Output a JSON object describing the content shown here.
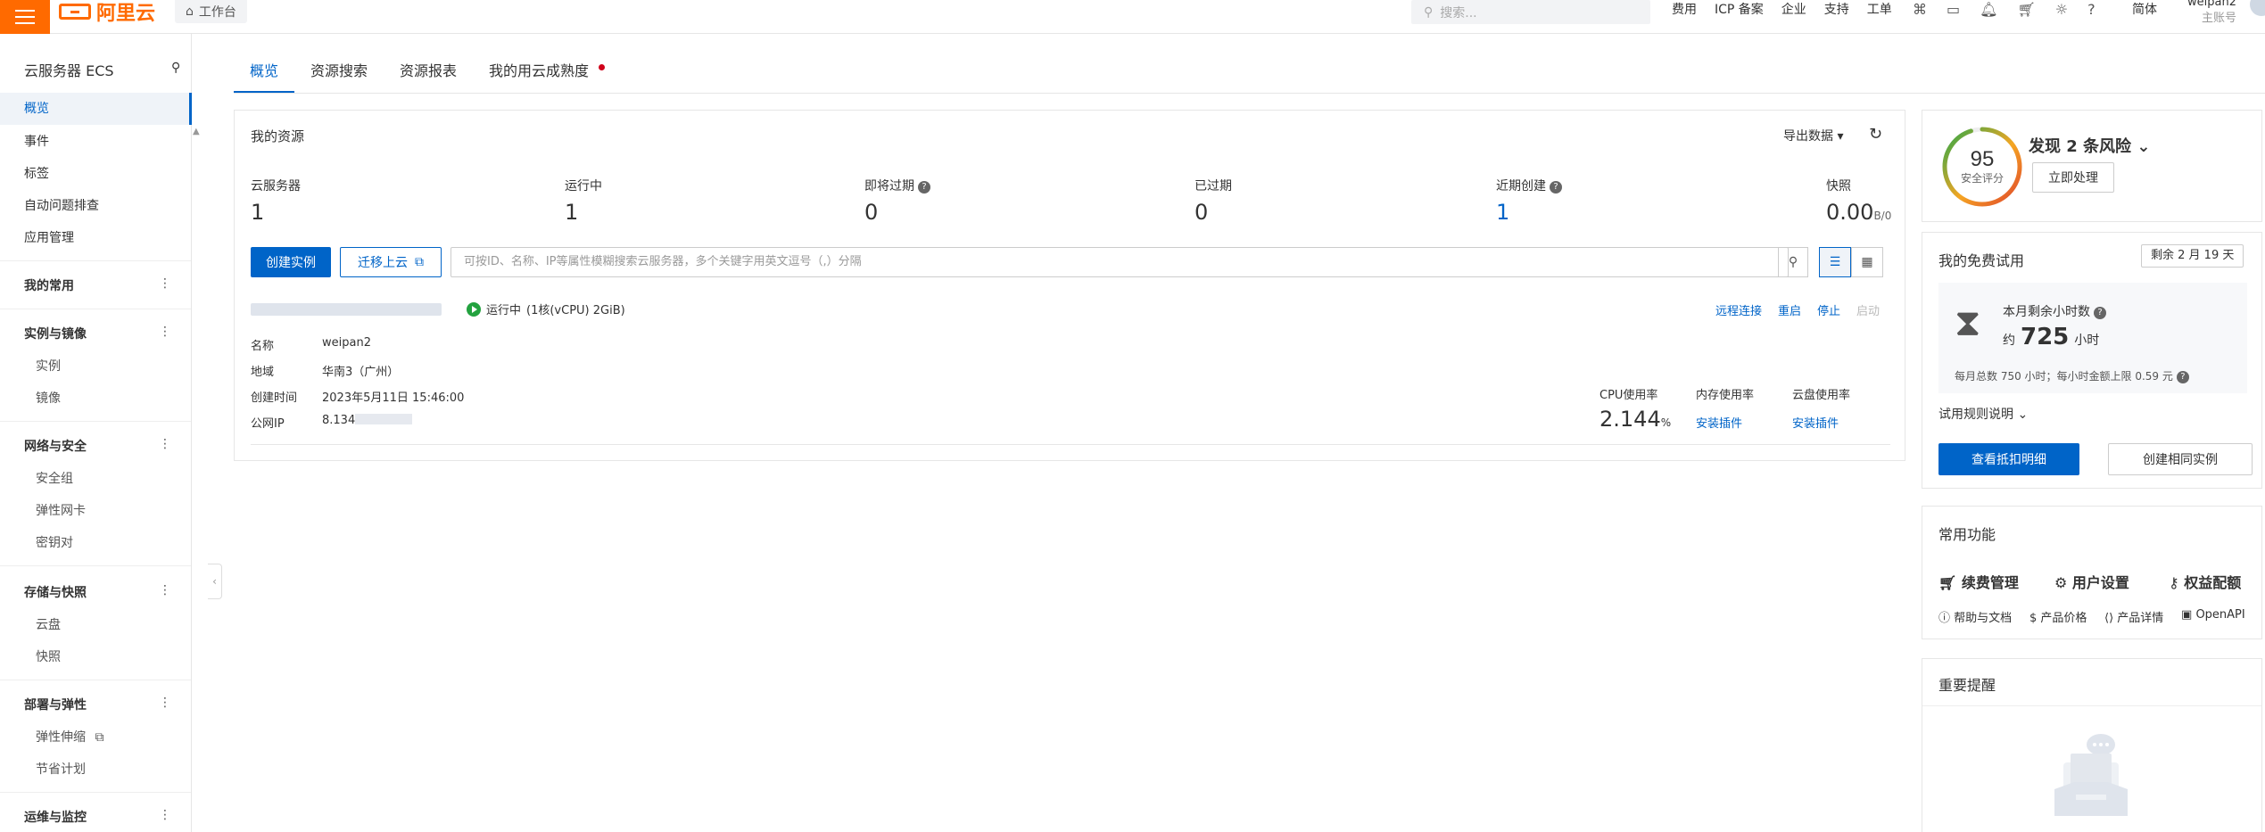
{
  "topbar": {
    "brand": "阿里云",
    "workbench": "工作台",
    "search_placeholder": "搜索...",
    "links": [
      "费用",
      "ICP 备案",
      "企业",
      "支持",
      "工单"
    ],
    "icons": [
      "code-icon",
      "screen-icon",
      "bell-icon",
      "cart-icon",
      "bulb-icon",
      "help-icon"
    ],
    "lang": "简体",
    "account_name": "weipan2",
    "account_type": "主账号"
  },
  "sidebar": {
    "title": "云服务器 ECS",
    "items": [
      "概览",
      "事件",
      "标签",
      "自动问题排查",
      "应用管理"
    ],
    "groups": [
      {
        "label": "我的常用",
        "subs": []
      },
      {
        "label": "实例与镜像",
        "subs": [
          "实例",
          "镜像"
        ]
      },
      {
        "label": "网络与安全",
        "subs": [
          "安全组",
          "弹性网卡",
          "密钥对"
        ]
      },
      {
        "label": "存储与快照",
        "subs": [
          "云盘",
          "快照"
        ]
      },
      {
        "label": "部署与弹性",
        "subs": [
          "弹性伸缩",
          "节省计划"
        ]
      },
      {
        "label": "运维与监控",
        "subs": []
      }
    ]
  },
  "tabs": [
    "概览",
    "资源搜索",
    "资源报表",
    "我的用云成熟度"
  ],
  "resources": {
    "title": "我的资源",
    "export": "导出数据",
    "stats": [
      {
        "label": "云服务器",
        "value": "1"
      },
      {
        "label": "运行中",
        "value": "1"
      },
      {
        "label": "即将过期",
        "value": "0"
      },
      {
        "label": "已过期",
        "value": "0"
      },
      {
        "label": "近期创建",
        "value": "1"
      },
      {
        "label": "快照",
        "value": "0.00",
        "unit": "B/0"
      }
    ],
    "create_btn": "创建实例",
    "migrate_btn": "迁移上云",
    "filter_placeholder": "可按ID、名称、IP等属性模糊搜索云服务器，多个关键字用英文逗号（,）分隔",
    "instance": {
      "status": "运行中",
      "spec": "(1核(vCPU) 2GiB)",
      "ops": [
        "远程连接",
        "重启",
        "停止",
        "启动"
      ],
      "fields": [
        {
          "k": "名称",
          "v": "weipan2"
        },
        {
          "k": "地域",
          "v": "华南3（广州）"
        },
        {
          "k": "创建时间",
          "v": "2023年5月11日 15:46:00"
        },
        {
          "k": "公网IP",
          "v": "8.134"
        }
      ],
      "cpu_label": "CPU使用率",
      "cpu_value": "2.144",
      "cpu_unit": "%",
      "mem_label": "内存使用率",
      "disk_label": "云盘使用率",
      "install_plugin": "安装插件"
    }
  },
  "security": {
    "score": "95",
    "score_label": "安全评分",
    "score_fraction": 0.95,
    "risk_title": "发现 2 条风险",
    "fix_btn": "立即处理"
  },
  "trial": {
    "title": "我的免费试用",
    "badge": "剩余 2 月 19 天",
    "remaining_label": "本月剩余小时数",
    "approx": "约",
    "hours": "725",
    "hours_unit": "小时",
    "quota_text": "每月总数 750 小时；每小时金额上限 0.59 元",
    "rule": "试用规则说明",
    "detail_btn": "查看抵扣明细",
    "same_btn": "创建相同实例"
  },
  "functions": {
    "title": "常用功能",
    "main": [
      "续费管理",
      "用户设置",
      "权益配额"
    ],
    "sub": [
      "帮助与文档",
      "产品价格",
      "产品详情",
      "OpenAPI"
    ]
  },
  "reminder": {
    "title": "重要提醒"
  },
  "colors": {
    "brand": "#ff6a00",
    "primary": "#0064c8",
    "running": "#23a23f",
    "alert_dot": "#d0021b"
  }
}
